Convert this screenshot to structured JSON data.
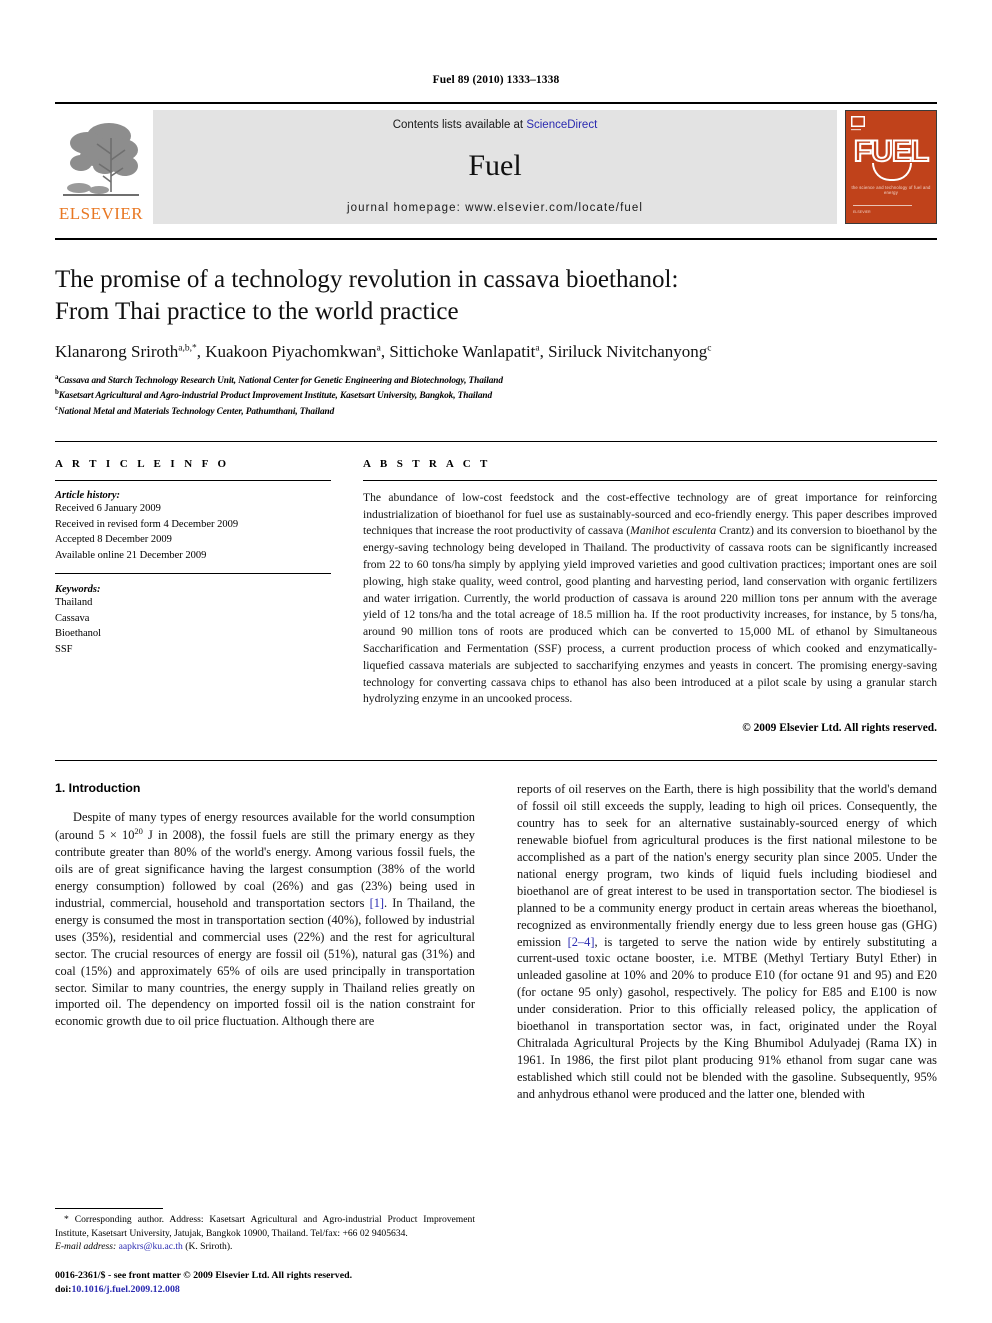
{
  "running_head": "Fuel 89 (2010) 1333–1338",
  "masthead": {
    "publisher_name": "ELSEVIER",
    "contents_prefix": "Contents lists available at ",
    "sciencedirect": "ScienceDirect",
    "journal_title": "Fuel",
    "homepage": "journal homepage: www.elsevier.com/locate/fuel",
    "cover_title": "FUEL",
    "cover_subtitle": "the science and technology of fuel and energy",
    "link_color": "#2a2ab0",
    "cover_color": "#C0421B",
    "elsevier_orange": "#E87722"
  },
  "article": {
    "title_line1": "The promise of a technology revolution in cassava bioethanol:",
    "title_line2": "From Thai practice to the world practice",
    "authors": "Klanarong Sriroth",
    "authors_full": "Klanarong Sriroth a,b,*, Kuakoon Piyachomkwan a, Sittichoke Wanlapatit a, Siriluck Nivitchanyong c",
    "author_list": [
      {
        "name": "Klanarong Sriroth",
        "marks": "a,b,*"
      },
      {
        "name": "Kuakoon Piyachomkwan",
        "marks": "a"
      },
      {
        "name": "Sittichoke Wanlapatit",
        "marks": "a"
      },
      {
        "name": "Siriluck Nivitchanyong",
        "marks": "c"
      }
    ],
    "affiliations": [
      {
        "mark": "a",
        "text": "Cassava and Starch Technology Research Unit, National Center for Genetic Engineering and Biotechnology, Thailand"
      },
      {
        "mark": "b",
        "text": "Kasetsart Agricultural and Agro-industrial Product Improvement Institute, Kasetsart University, Bangkok, Thailand"
      },
      {
        "mark": "c",
        "text": "National Metal and Materials Technology Center, Pathumthani, Thailand"
      }
    ]
  },
  "article_info": {
    "heading": "A R T I C L E   I N F O",
    "history_label": "Article history:",
    "history": [
      "Received 6 January 2009",
      "Received in revised form 4 December 2009",
      "Accepted 8 December 2009",
      "Available online 21 December 2009"
    ],
    "keywords_label": "Keywords:",
    "keywords": [
      "Thailand",
      "Cassava",
      "Bioethanol",
      "SSF"
    ]
  },
  "abstract": {
    "heading": "A B S T R A C T",
    "part1": "The abundance of low-cost feedstock and the cost-effective technology are of great importance for reinforcing industrialization of bioethanol for fuel use as sustainably-sourced and eco-friendly energy. This paper describes improved techniques that increase the root productivity of cassava (",
    "species": "Manihot esculenta",
    "part2": " Crantz) and its conversion to bioethanol by the energy-saving technology being developed in Thailand. The productivity of cassava roots can be significantly increased from 22 to 60 tons/ha simply by applying yield improved varieties and good cultivation practices; important ones are soil plowing, high stake quality, weed control, good planting and harvesting period, land conservation with organic fertilizers and water irrigation. Currently, the world production of cassava is around 220 million tons per annum with the average yield of 12 tons/ha and the total acreage of 18.5 million ha. If the root productivity increases, for instance, by 5 tons/ha, around 90 million tons of roots are produced which can be converted to 15,000 ML of ethanol by Simultaneous Saccharification and Fermentation (SSF) process, a current production process of which cooked and enzymatically-liquefied cassava materials are subjected to saccharifying enzymes and yeasts in concert. The promising energy-saving technology for converting cassava chips to ethanol has also been introduced at a pilot scale by using a granular starch hydrolyzing enzyme in an uncooked process.",
    "copyright": "© 2009 Elsevier Ltd. All rights reserved."
  },
  "body": {
    "section_title": "1. Introduction",
    "left_p1_a": "Despite of many types of energy resources available for the world consumption (around 5 × 10",
    "left_p1_exp": "20",
    "left_p1_b": " J in 2008), the fossil fuels are still the primary energy as they contribute greater than 80% of the world's energy. Among various fossil fuels, the oils are of great significance having the largest consumption (38% of the world energy consumption) followed by coal (26%) and gas (23%) being used in industrial, commercial, household and transportation sectors ",
    "left_cite1": "[1]",
    "left_p1_c": ". In Thailand, the energy is consumed the most in transportation section (40%), followed by industrial uses (35%), residential and commercial uses (22%) and the rest for agricultural sector. The crucial resources of energy are fossil oil (51%), natural gas (31%) and coal (15%) and approximately 65% of oils are used principally in transportation sector. Similar to many countries, the energy supply in Thailand relies greatly on imported oil. The dependency on imported fossil oil is the nation constraint for economic growth due to oil price fluctuation. Although there are",
    "right_p1_a": "reports of oil reserves on the Earth, there is high possibility that the world's demand of fossil oil still exceeds the supply, leading to high oil prices. Consequently, the country has to seek for an alternative sustainably-sourced energy of which renewable biofuel from agricultural produces is the first national milestone to be accomplished as a part of the nation's energy security plan since 2005. Under the national energy program, two kinds of liquid fuels including biodiesel and bioethanol are of great interest to be used in transportation sector. The biodiesel is planned to be a community energy product in certain areas whereas the bioethanol, recognized as environmentally friendly energy due to less green house gas (GHG) emission ",
    "right_cite1": "[2–4]",
    "right_p1_b": ", is targeted to serve the nation wide by entirely substituting a current-used toxic octane booster, i.e. MTBE (Methyl Tertiary Butyl Ether) in unleaded gasoline at 10% and 20% to produce E10 (for octane 91 and 95) and E20 (for octane 95 only) gasohol, respectively. The policy for E85 and E100 is now under consideration. Prior to this officially released policy, the application of bioethanol in transportation sector was, in fact, originated under the Royal Chitralada Agricultural Projects by the King Bhumibol Adulyadej (Rama IX) in 1961. In 1986, the first pilot plant producing 91% ethanol from sugar cane was established which still could not be blended with the gasoline. Subsequently, 95% and anhydrous ethanol were produced and the latter one, blended with"
  },
  "footnotes": {
    "corresponding": "* Corresponding author. Address: Kasetsart Agricultural and Agro-industrial Product Improvement Institute, Kasetsart University, Jatujak, Bangkok 10900, Thailand. Tel/fax: +66 02 9405634.",
    "email_label": "E-mail address:",
    "email": "aapkrs@ku.ac.th",
    "email_suffix": " (K. Sriroth).",
    "issn_line": "0016-2361/$ - see front matter © 2009 Elsevier Ltd. All rights reserved.",
    "doi_label": "doi:",
    "doi": "10.1016/j.fuel.2009.12.008"
  }
}
